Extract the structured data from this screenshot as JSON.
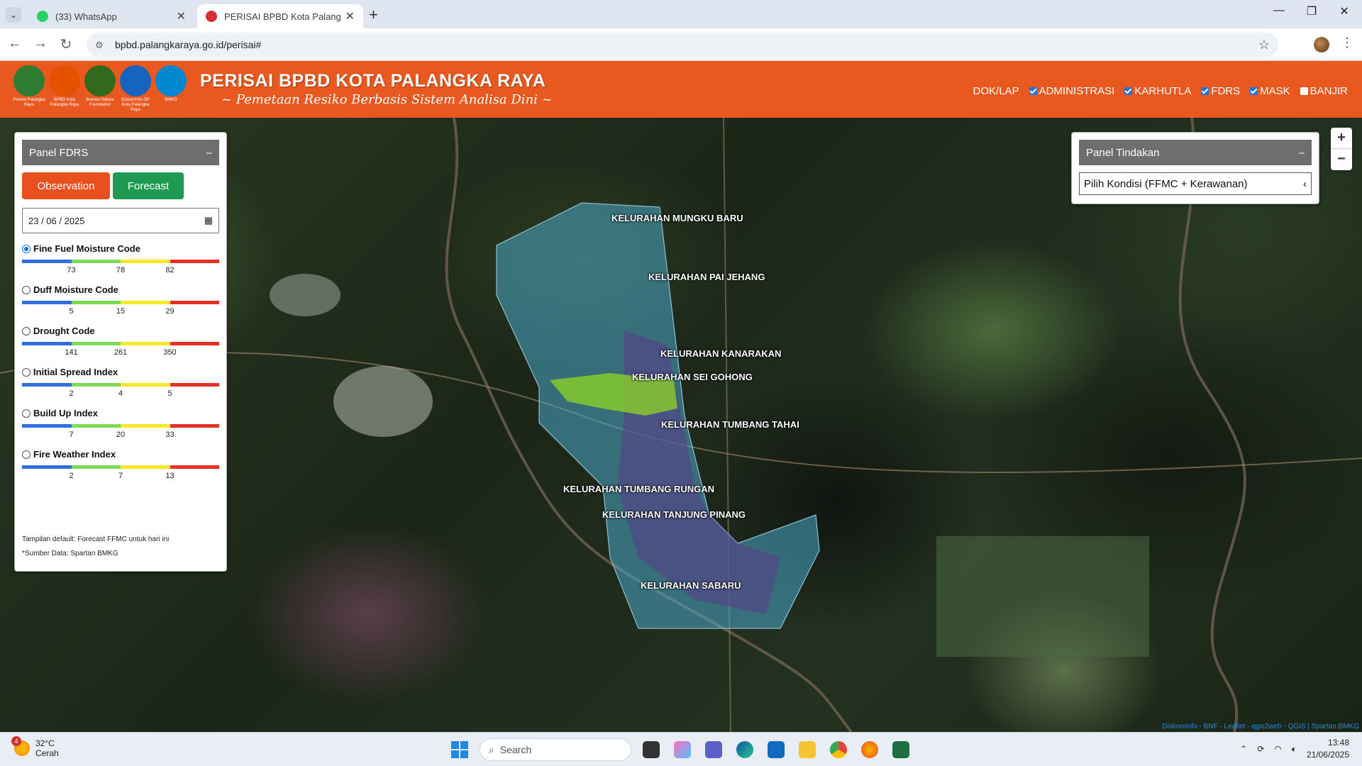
{
  "browser": {
    "tabs": [
      {
        "title": "(33) WhatsApp",
        "active": false,
        "favicon_color": "#25d366"
      },
      {
        "title": "PERISAI BPBD Kota Palangka Ra",
        "active": true,
        "favicon_color": "#d32f2f"
      }
    ],
    "url": "bpbd.palangkaraya.go.id/perisai#"
  },
  "header": {
    "logos": [
      {
        "caption": "Pemko Palangka Raya",
        "color": "#2e7d32"
      },
      {
        "caption": "BPBD Kota Palangka Raya",
        "color": "#e65100"
      },
      {
        "caption": "Borneo Nature Foundation",
        "color": "#33691e"
      },
      {
        "caption": "Diskominfo-SP Kota Palangka Raya",
        "color": "#1565c0"
      },
      {
        "caption": "BMKG",
        "color": "#0288d1"
      }
    ],
    "title": "PERISAI BPBD KOTA PALANGKA RAYA",
    "subtitle": "~ Pemetaan Resiko Berbasis Sistem Analisa Dini ~",
    "nav": {
      "doklap": "DOK/LAP",
      "layers": [
        {
          "label": "ADMINISTRASI",
          "checked": true
        },
        {
          "label": "KARHUTLA",
          "checked": true
        },
        {
          "label": "FDRS",
          "checked": true
        },
        {
          "label": "MASK",
          "checked": true
        },
        {
          "label": "BANJIR",
          "checked": false
        }
      ]
    },
    "accent_color": "#e8581f"
  },
  "panel_fdrs": {
    "title": "Panel FDRS",
    "collapse": "–",
    "observation_label": "Observation",
    "forecast_label": "Forecast",
    "date": "23 / 06 / 2025",
    "indices": [
      {
        "name": "Fine Fuel Moisture Code",
        "selected": true,
        "ticks": [
          "73",
          "78",
          "82"
        ]
      },
      {
        "name": "Duff Moisture Code",
        "selected": false,
        "ticks": [
          "5",
          "15",
          "29"
        ]
      },
      {
        "name": "Drought Code",
        "selected": false,
        "ticks": [
          "141",
          "261",
          "350"
        ]
      },
      {
        "name": "Initial Spread Index",
        "selected": false,
        "ticks": [
          "2",
          "4",
          "5"
        ]
      },
      {
        "name": "Build Up Index",
        "selected": false,
        "ticks": [
          "7",
          "20",
          "33"
        ]
      },
      {
        "name": "Fire Weather Index",
        "selected": false,
        "ticks": [
          "2",
          "7",
          "13"
        ]
      }
    ],
    "scale_colors": [
      "#2f6fe0",
      "#7ed957",
      "#f4ea2a",
      "#e53025"
    ],
    "note_default": "Tampilan default: Forecast FFMC untuk hari ini",
    "note_source": "*Sumber Data: Spartan BMKG"
  },
  "panel_tindakan": {
    "title": "Panel Tindakan",
    "collapse": "–",
    "select_value": "Pilih Kondisi (FFMC + Kerawanan)"
  },
  "map": {
    "regions": [
      "KELURAHAN MUNGKU BARU",
      "KELURAHAN PAI JEHANG",
      "KELURAHAN KANARAKAN",
      "KELURAHAN SEI GOHONG",
      "KELURAHAN TUMBANG TAHAI",
      "KELURAHAN TUMBANG RUNGAN",
      "KELURAHAN TANJUNG PINANG",
      "KELURAHAN SABARU"
    ],
    "zoom_in": "+",
    "zoom_out": "−",
    "attribution": "Diskominfo - BNF - Leaflet - qgis2web - QGIS | Spartan BMKG"
  },
  "taskbar": {
    "temperature": "32°C",
    "condition": "Cerah",
    "badge": "4",
    "search_placeholder": "Search",
    "time": "13:48",
    "date": "21/06/2025"
  }
}
